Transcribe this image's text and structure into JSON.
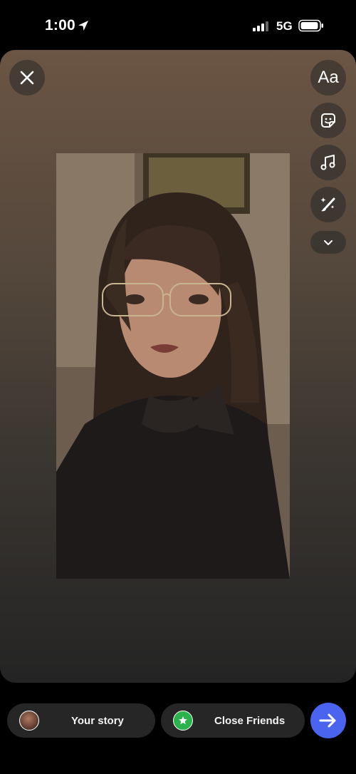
{
  "status_bar": {
    "time": "1:00",
    "network": "5G"
  },
  "editor": {
    "text_tool_label": "Aa",
    "icons": [
      "close-icon",
      "sticker-icon",
      "music-icon",
      "effects-brush-icon",
      "chevron-down-icon"
    ]
  },
  "bottom_bar": {
    "your_story_label": "Your story",
    "close_friends_label": "Close Friends",
    "share_icon": "arrow-right-icon"
  },
  "colors": {
    "share_button": "#4a64f0",
    "close_friends_badge": "#2bb24c",
    "pill_background": "#262626"
  }
}
